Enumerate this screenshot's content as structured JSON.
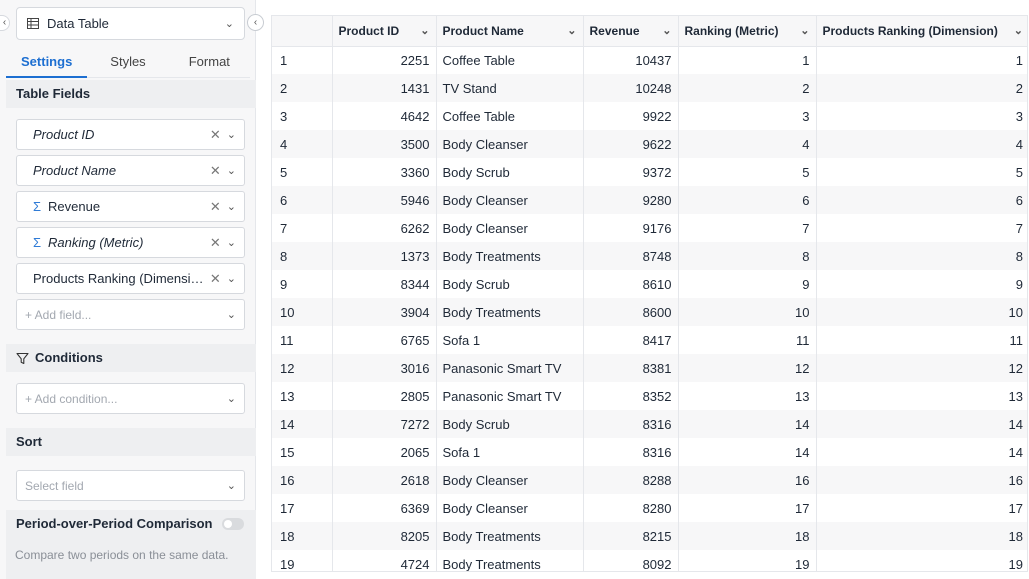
{
  "panel": {
    "viz_type": "Data Table",
    "tabs": [
      {
        "label": "Settings",
        "active": true
      },
      {
        "label": "Styles",
        "active": false
      },
      {
        "label": "Format",
        "active": false
      }
    ],
    "table_fields": {
      "title": "Table Fields",
      "fields": [
        {
          "name": "Product ID",
          "italic": true,
          "sigma": false
        },
        {
          "name": "Product Name",
          "italic": true,
          "sigma": false
        },
        {
          "name": "Revenue",
          "italic": false,
          "sigma": true
        },
        {
          "name": "Ranking (Metric)",
          "italic": true,
          "sigma": true
        },
        {
          "name": "Products Ranking (Dimension)",
          "italic": false,
          "sigma": false
        }
      ],
      "add_placeholder": "+ Add field..."
    },
    "conditions": {
      "title": "Conditions",
      "add_placeholder": "+ Add condition..."
    },
    "sort": {
      "title": "Sort",
      "placeholder": "Select field"
    },
    "pop": {
      "title": "Period-over-Period Comparison",
      "enabled": false,
      "description": "Compare two periods on the same data."
    }
  },
  "table": {
    "columns": [
      "",
      "Product ID",
      "Product Name",
      "Revenue",
      "Ranking (Metric)",
      "Products Ranking (Dimension)"
    ],
    "rows": [
      [
        "1",
        "2251",
        "Coffee Table",
        "10437",
        "1",
        "1"
      ],
      [
        "2",
        "1431",
        "TV Stand",
        "10248",
        "2",
        "2"
      ],
      [
        "3",
        "4642",
        "Coffee Table",
        "9922",
        "3",
        "3"
      ],
      [
        "4",
        "3500",
        "Body Cleanser",
        "9622",
        "4",
        "4"
      ],
      [
        "5",
        "3360",
        "Body Scrub",
        "9372",
        "5",
        "5"
      ],
      [
        "6",
        "5946",
        "Body Cleanser",
        "9280",
        "6",
        "6"
      ],
      [
        "7",
        "6262",
        "Body Cleanser",
        "9176",
        "7",
        "7"
      ],
      [
        "8",
        "1373",
        "Body Treatments",
        "8748",
        "8",
        "8"
      ],
      [
        "9",
        "8344",
        "Body Scrub",
        "8610",
        "9",
        "9"
      ],
      [
        "10",
        "3904",
        "Body Treatments",
        "8600",
        "10",
        "10"
      ],
      [
        "11",
        "6765",
        "Sofa 1",
        "8417",
        "11",
        "11"
      ],
      [
        "12",
        "3016",
        "Panasonic Smart TV",
        "8381",
        "12",
        "12"
      ],
      [
        "13",
        "2805",
        "Panasonic Smart TV",
        "8352",
        "13",
        "13"
      ],
      [
        "14",
        "7272",
        "Body Scrub",
        "8316",
        "14",
        "14"
      ],
      [
        "15",
        "2065",
        "Sofa 1",
        "8316",
        "14",
        "14"
      ],
      [
        "16",
        "2618",
        "Body Cleanser",
        "8288",
        "16",
        "16"
      ],
      [
        "17",
        "6369",
        "Body Cleanser",
        "8280",
        "17",
        "17"
      ],
      [
        "18",
        "8205",
        "Body Treatments",
        "8215",
        "18",
        "18"
      ],
      [
        "19",
        "4724",
        "Body Treatments",
        "8092",
        "19",
        "19"
      ]
    ]
  },
  "colors": {
    "accent": "#1d6fd1",
    "sigma": "#2f7bd6"
  }
}
